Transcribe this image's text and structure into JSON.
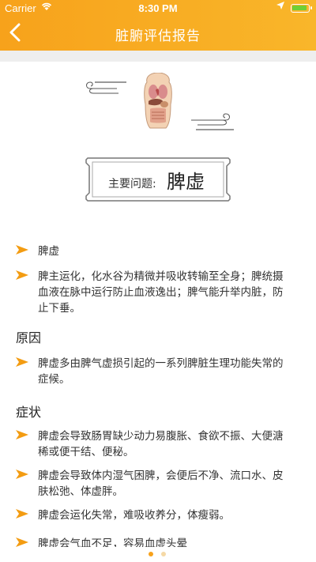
{
  "status_bar": {
    "carrier": "Carrier",
    "time": "8:30 PM"
  },
  "nav": {
    "title": "脏腑评估报告",
    "back_icon": "chevron-left-icon"
  },
  "summary": {
    "label": "主要问题:",
    "value": "脾虚"
  },
  "overview_items": [
    "脾虚",
    "脾主运化，化水谷为精微并吸收转输至全身；脾统摄血液在脉中运行防止血液逸出；脾气能升举内脏，防止下垂。"
  ],
  "cause": {
    "heading": "原因",
    "items": [
      "脾虚多由脾气虚损引起的一系列脾脏生理功能失常的症候。"
    ]
  },
  "symptoms": {
    "heading": "症状",
    "items": [
      "脾虚会导致肠胃缺少动力易腹胀、食欲不振、大便溏稀或便干结、便秘。",
      "脾虚会导致体内湿气困脾，会便后不净、流口水、皮肤松弛、体虚胖。",
      "脾虚会运化失常，难吸收养分，体瘦弱。",
      "脾虚会气血不足，容易血虚头晕"
    ]
  },
  "pager": {
    "pages": 2,
    "active": 1
  },
  "colors": {
    "accent": "#f7a21b",
    "arrow": "#f39c12",
    "dot_active": "#f7a21b",
    "dot_inactive": "#f5d9a6"
  }
}
